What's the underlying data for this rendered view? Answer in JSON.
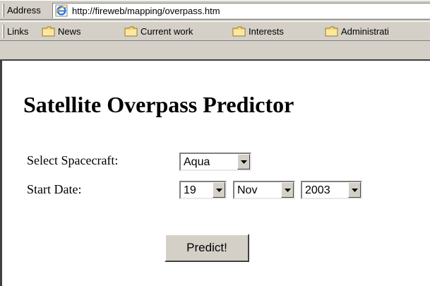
{
  "browser": {
    "address_label": "Address",
    "url": "http://fireweb/mapping/overpass.htm",
    "links_label": "Links",
    "links": [
      "News",
      "Current work",
      "Interests",
      "Administrati"
    ]
  },
  "page": {
    "title": "Satellite Overpass Predictor",
    "form": {
      "spacecraft_label": "Select Spacecraft:",
      "spacecraft_value": "Aqua",
      "start_date_label": "Start Date:",
      "day_value": "19",
      "month_value": "Nov",
      "year_value": "2003",
      "predict_label": "Predict!"
    }
  },
  "colors": {
    "chrome": "#d4d0c8",
    "folder": "#f5d675",
    "ie_icon": "#1f6fd1"
  },
  "icons": {
    "address": "ie-page-icon",
    "links": "folder-icon",
    "dropdown": "chevron-down-icon"
  }
}
